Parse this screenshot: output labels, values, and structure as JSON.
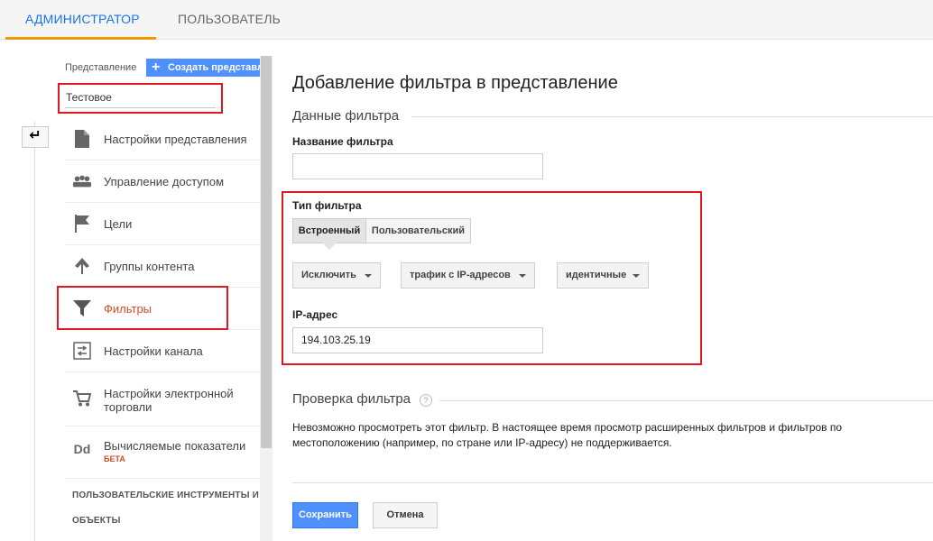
{
  "top_tabs": [
    {
      "label": "АДМИНИСТРАТОР",
      "active": true
    },
    {
      "label": "ПОЛЬЗОВАТЕЛЬ",
      "active": false
    }
  ],
  "sidebar": {
    "view_label": "Представление",
    "create_button": "Создать представление",
    "view_value": "Тестовое",
    "back_icon": "arrow-left-icon",
    "items": [
      {
        "label": "Настройки представления",
        "icon": "document-icon"
      },
      {
        "label": "Управление доступом",
        "icon": "users-icon"
      },
      {
        "label": "Цели",
        "icon": "flag-icon"
      },
      {
        "label": "Группы контента",
        "icon": "content-groups-icon"
      },
      {
        "label": "Фильтры",
        "icon": "filter-icon",
        "active": true
      },
      {
        "label": "Настройки канала",
        "icon": "channel-icon"
      },
      {
        "label": "Настройки электронной торговли",
        "icon": "cart-icon"
      },
      {
        "label": "Вычисляемые показатели",
        "icon": "dd-icon",
        "badge": "БЕТА"
      }
    ],
    "sections": [
      "ПОЛЬЗОВАТЕЛЬСКИЕ ИНСТРУМЕНТЫ И",
      "ОБЪЕКТЫ"
    ]
  },
  "main": {
    "title": "Добавление фильтра в представление",
    "data_legend": "Данные фильтра",
    "filter_name_label": "Название фильтра",
    "filter_name_value": "",
    "filter_type_label": "Тип фильтра",
    "type_segments": [
      {
        "label": "Встроенный",
        "active": true
      },
      {
        "label": "Пользовательский",
        "active": false
      }
    ],
    "dropdowns": [
      {
        "value": "Исключить"
      },
      {
        "value": "трафик с IP-адресов"
      },
      {
        "value": "идентичные"
      }
    ],
    "ip_label": "IP-адрес",
    "ip_value": "194.103.25.19",
    "check_legend": "Проверка фильтра",
    "help_glyph": "?",
    "check_text": "Невозможно просмотреть этот фильтр. В настоящее время просмотр расширенных фильтров и фильтров по местоположению (например, по стране или IP-адресу) не поддерживается.",
    "save_label": "Сохранить",
    "cancel_label": "Отмена"
  }
}
